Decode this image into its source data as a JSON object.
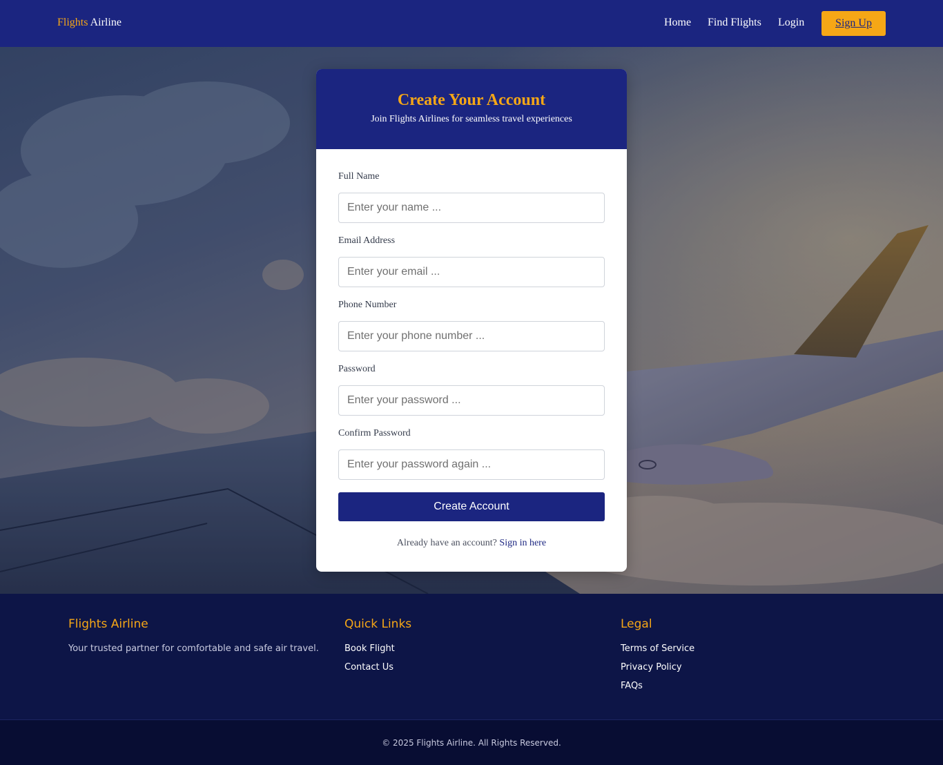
{
  "header": {
    "brand_accent": "Flights",
    "brand_rest": "Airline",
    "nav": [
      "Home",
      "Find Flights",
      "Login"
    ],
    "signup_label": "Sign Up"
  },
  "form": {
    "title": "Create Your Account",
    "subtitle": "Join Flights Airlines for seamless travel experiences",
    "fields": [
      {
        "label": "Full Name",
        "placeholder": "Enter your name ..."
      },
      {
        "label": "Email Address",
        "placeholder": "Enter your email ..."
      },
      {
        "label": "Phone Number",
        "placeholder": "Enter your phone number ..."
      },
      {
        "label": "Password",
        "placeholder": "Enter your password ..."
      },
      {
        "label": "Confirm Password",
        "placeholder": "Enter your password again ..."
      }
    ],
    "submit_label": "Create Account",
    "signin_prompt": "Already have an account?",
    "signin_link": "Sign in here"
  },
  "footer": {
    "brand_title": "Flights Airline",
    "brand_text": "Your trusted partner for comfortable and safe air travel.",
    "quick_title": "Quick Links",
    "quick_links": [
      "Book Flight",
      "Contact Us"
    ],
    "legal_title": "Legal",
    "legal_links": [
      "Terms of Service",
      "Privacy Policy",
      "FAQs"
    ],
    "copyright": "© 2025 Flights Airline. All Rights Reserved."
  },
  "colors": {
    "primary": "#1b2580",
    "accent": "#f6a716",
    "footer_bg": "#0d1547",
    "bottom_bg": "#080d33"
  }
}
